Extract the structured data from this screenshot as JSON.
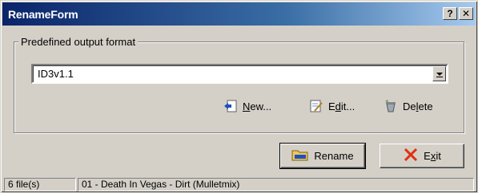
{
  "window": {
    "title": "RenameForm",
    "help_glyph": "?",
    "close_glyph": "✕"
  },
  "group": {
    "label": "Predefined output format",
    "selected_format": "ID3v1.1"
  },
  "actions": {
    "new_label_u": "N",
    "new_label_rest": "ew...",
    "edit_label_pre": "E",
    "edit_label_u": "d",
    "edit_label_rest": "it...",
    "delete_label_pre": "De",
    "delete_label_u": "l",
    "delete_label_rest": "ete"
  },
  "buttons": {
    "rename": "Rename",
    "exit_pre": "E",
    "exit_u": "x",
    "exit_rest": "it"
  },
  "status": {
    "file_count": "6 file(s)",
    "current_file": "01 - Death In Vegas - Dirt (Mulletmix)"
  },
  "colors": {
    "title_gradient_start": "#0a246a",
    "title_gradient_end": "#a6caf0",
    "face": "#d4d0c8",
    "exit_icon": "#e03010"
  },
  "icons": [
    "new-icon",
    "edit-icon",
    "delete-icon",
    "rename-icon",
    "exit-icon"
  ]
}
